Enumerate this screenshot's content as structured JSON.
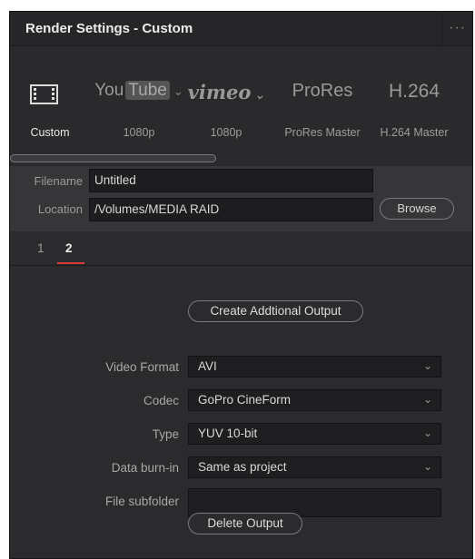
{
  "window": {
    "title": "Render Settings - Custom",
    "more_glyph": "···"
  },
  "presets": [
    {
      "id": "custom",
      "label": "Custom",
      "icon": "film-strip-icon",
      "active": true
    },
    {
      "id": "youtube",
      "label": "1080p",
      "logo_you": "You",
      "logo_tube": "Tube",
      "chevron": "⌄"
    },
    {
      "id": "vimeo",
      "label": "1080p",
      "logo": "vimeo",
      "chevron": "⌄"
    },
    {
      "id": "prores",
      "label": "ProRes Master",
      "logo": "ProRes"
    },
    {
      "id": "h264",
      "label": "H.264 Master",
      "logo": "H.264"
    }
  ],
  "file": {
    "filename_label": "Filename",
    "filename_value": "Untitled",
    "location_label": "Location",
    "location_value": "/Volumes/MEDIA RAID",
    "browse_label": "Browse"
  },
  "tabs": [
    {
      "label": "1",
      "active": false
    },
    {
      "label": "2",
      "active": true
    }
  ],
  "output": {
    "create_label": "Create Addtional Output",
    "delete_label": "Delete Output",
    "fields": [
      {
        "label": "Video Format",
        "value": "AVI"
      },
      {
        "label": "Codec",
        "value": "GoPro CineForm"
      },
      {
        "label": "Type",
        "value": "YUV 10-bit"
      },
      {
        "label": "Data burn-in",
        "value": "Same as project"
      }
    ],
    "subfolder_label": "File subfolder",
    "subfolder_value": ""
  },
  "colors": {
    "panel_bg": "#2b2b2e",
    "tab_underline": "#d63a3a"
  }
}
